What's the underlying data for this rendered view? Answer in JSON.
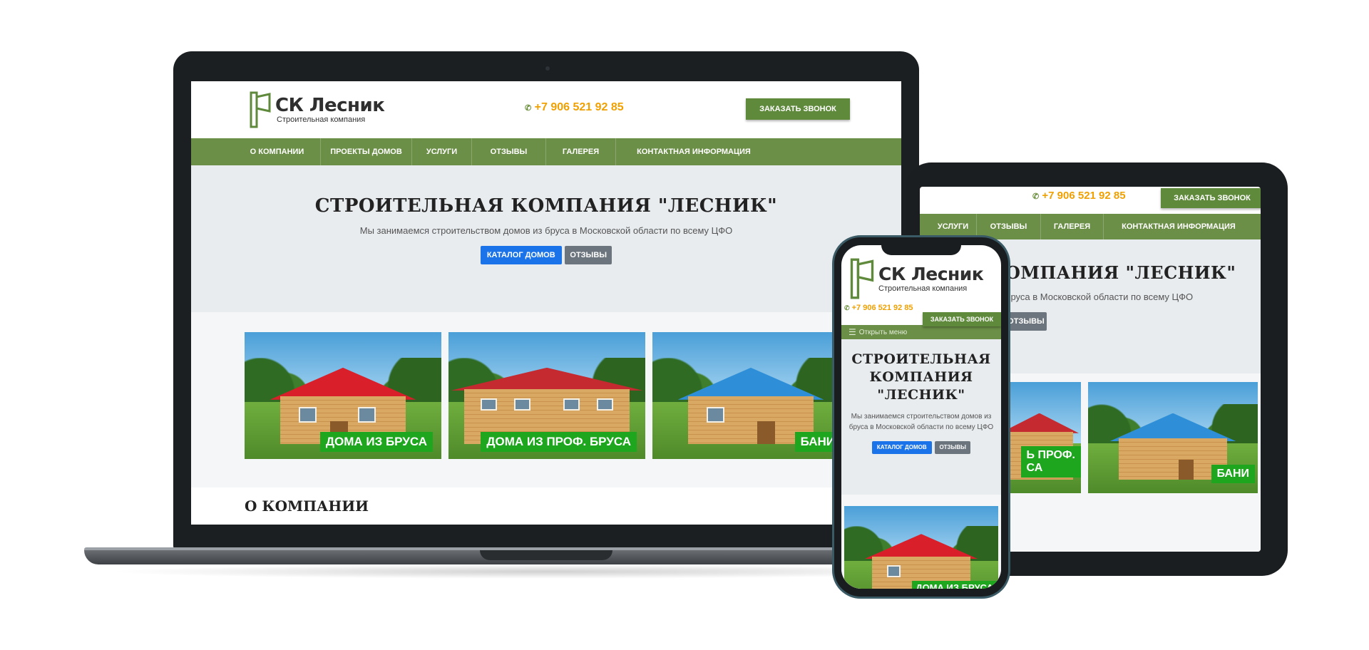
{
  "site": {
    "logo_title": "СК Лесник",
    "logo_subtitle": "Строительная компания",
    "phone": "+7 906 521 92 85",
    "cta_label": "ЗАКАЗАТЬ ЗВОНОК",
    "nav": [
      "О КОМПАНИИ",
      "ПРОЕКТЫ ДОМОВ",
      "УСЛУГИ",
      "ОТЗЫВЫ",
      "ГАЛЕРЕЯ",
      "КОНТАКТНАЯ ИНФОРМАЦИЯ"
    ],
    "hero_title": "СТРОИТЕЛЬНАЯ КОМПАНИЯ \"ЛЕСНИК\"",
    "hero_text": "Мы занимаемся строительством домов из бруса в Московской области по всему ЦФО",
    "btn_catalog": "КАТАЛОГ ДОМОВ",
    "btn_reviews": "ОТЗЫВЫ",
    "cards": [
      "ДОМА ИЗ БРУСА",
      "ДОМА ИЗ ПРОФ. БРУСА",
      "БАНИ"
    ],
    "section_title": "О КОМПАНИИ",
    "menu_toggle": "Открыть меню"
  },
  "tablet": {
    "nav": [
      "УСЛУГИ",
      "ОТЗЫВЫ",
      "ГАЛЕРЕЯ",
      "КОНТАКТНАЯ ИНФОРМАЦИЯ"
    ],
    "hero_title_partial": "ОМПАНИЯ \"ЛЕСНИК\"",
    "hero_text_partial": "бруса в Московской области по всему ЦФО",
    "card_partial": "Ь ПРОФ.\nСА",
    "card_bani": "БАНИ"
  },
  "phone_view": {
    "hero_title": "СТРОИТЕЛЬНАЯ КОМПАНИЯ \"ЛЕСНИК\""
  },
  "colors": {
    "brand_green": "#6b8f47",
    "cta_green": "#5f8a3c",
    "phone_orange": "#f0a000",
    "btn_blue": "#1a73e8",
    "btn_gray": "#6c757d",
    "tag_green": "#1ea61e",
    "hero_bg": "#e8ecef"
  },
  "roof_colors": [
    "#d81f2a",
    "#c42a2f",
    "#2e8fd8"
  ],
  "icons": {
    "logo": "axe-logo-icon",
    "phone": "phone-icon",
    "menu": "hamburger-menu-icon"
  }
}
